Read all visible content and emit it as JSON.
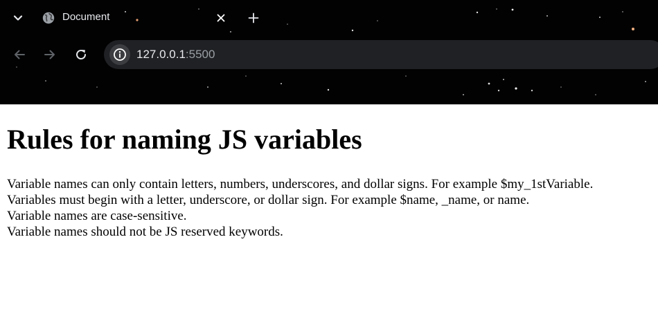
{
  "browser": {
    "tab": {
      "title": "Document",
      "favicon": "globe-icon"
    },
    "toolbar": {
      "url_host": "127.0.0.1",
      "url_port": ":5500"
    },
    "icons": {
      "tab_list": "chevron-down-icon",
      "close_tab": "close-icon",
      "new_tab": "plus-icon",
      "back": "back-arrow-icon",
      "forward": "forward-arrow-icon",
      "reload": "reload-icon",
      "site_info": "info-icon"
    },
    "colors": {
      "chrome_bg": "#020203",
      "omnibox_bg": "#202124",
      "text": "#e8eaed",
      "muted": "#9aa0a6"
    }
  },
  "page": {
    "heading": "Rules for naming JS variables",
    "rules": [
      "Variable names can only contain letters, numbers, underscores, and dollar signs. For example $my_1stVariable.",
      "Variables must begin with a letter, underscore, or dollar sign. For example $name, _name, or name.",
      "Variable names are case-sensitive.",
      "Variable names should not be JS reserved keywords."
    ]
  }
}
